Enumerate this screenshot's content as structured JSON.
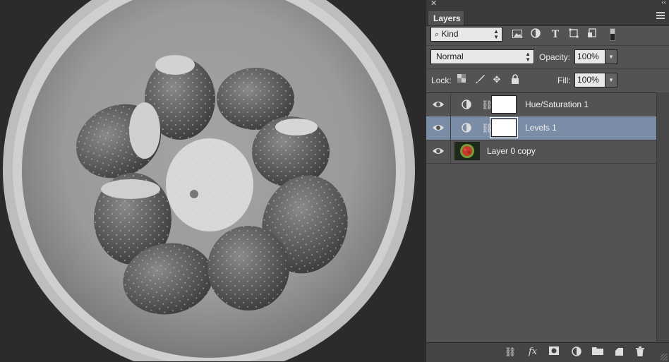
{
  "panel": {
    "title": "Layers",
    "close_glyph": "✕",
    "collapse_glyph": "‹‹",
    "filter": {
      "kind_label": "Kind",
      "filter_icons": [
        "pixel-filter-icon",
        "adjustment-filter-icon",
        "type-filter-icon",
        "shape-filter-icon",
        "smart-object-filter-icon"
      ]
    },
    "blend_mode": "Normal",
    "opacity_label": "Opacity:",
    "opacity_value": "100%",
    "lock_label": "Lock:",
    "fill_label": "Fill:",
    "fill_value": "100%"
  },
  "layers": [
    {
      "name": "Hue/Saturation 1",
      "type": "adjustment",
      "selected": false,
      "visible": true
    },
    {
      "name": "Levels 1",
      "type": "adjustment",
      "selected": true,
      "visible": true
    },
    {
      "name": "Layer 0 copy",
      "type": "pixel",
      "selected": false,
      "visible": true
    }
  ],
  "bottom_icons": [
    "link-layers-icon",
    "fx-icon",
    "add-mask-icon",
    "new-adjustment-icon",
    "new-group-icon",
    "new-layer-icon",
    "delete-layer-icon"
  ],
  "colors": {
    "panel_bg": "#535353",
    "selected_row": "#7b8ca7",
    "canvas_bg": "#2e2e2e"
  }
}
